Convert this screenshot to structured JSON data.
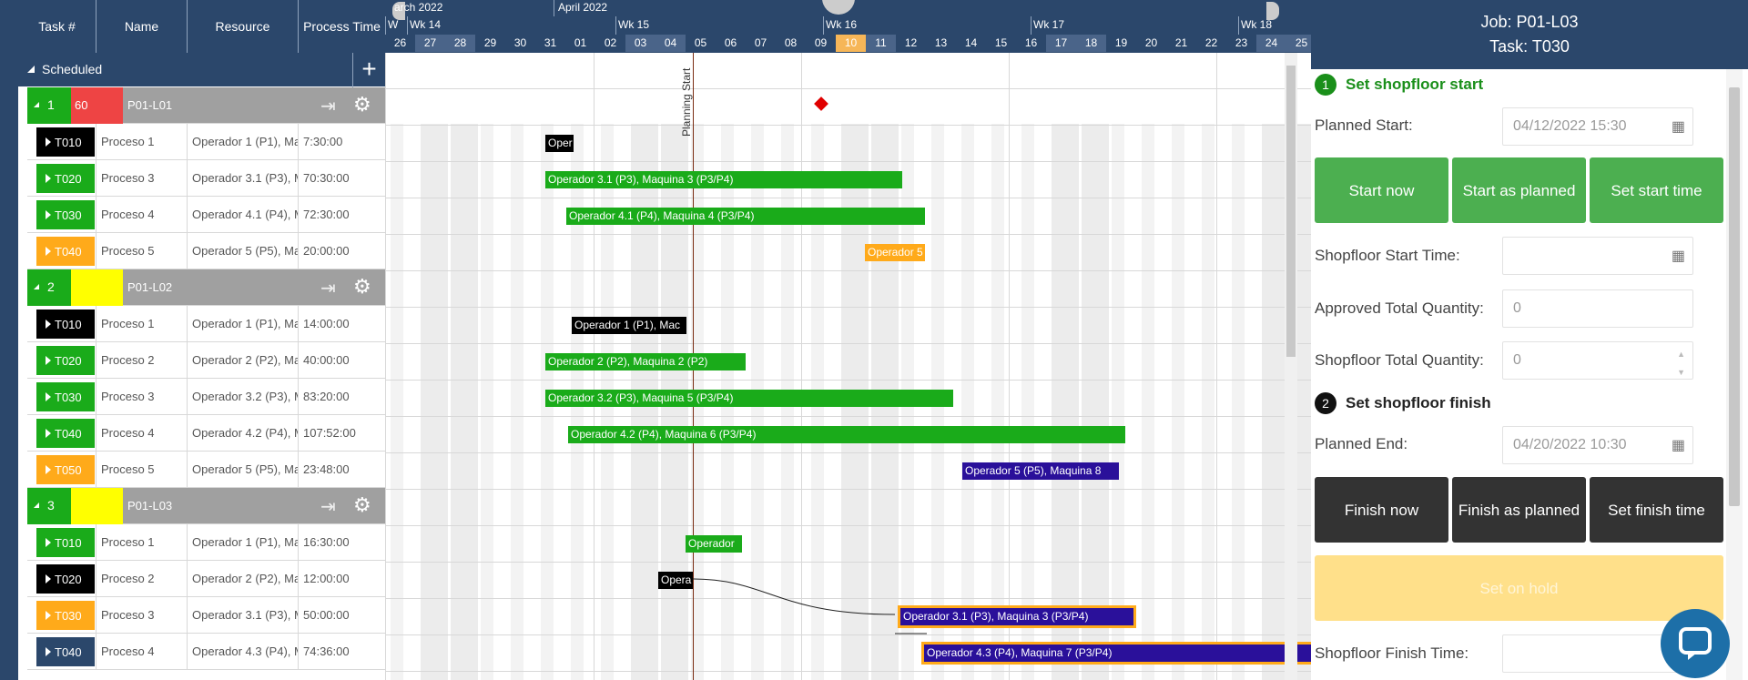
{
  "grid": {
    "headers": [
      "Task #",
      "Name",
      "Resource",
      "Process Time"
    ],
    "scheduled_label": "Scheduled",
    "plus": "+"
  },
  "jobs": [
    {
      "num": "1",
      "priority": "60",
      "priority_color": "#ee4444",
      "name": "P01-L01",
      "num_color": "#1aab1a",
      "tasks": [
        {
          "id": "T010",
          "color": "#000000",
          "name": "Proceso 1",
          "resource": "Operador 1 (P1), Ma",
          "time": "7:30:00"
        },
        {
          "id": "T020",
          "color": "#1aab1a",
          "name": "Proceso 3",
          "resource": "Operador 3.1 (P3), M",
          "time": "70:30:00"
        },
        {
          "id": "T030",
          "color": "#1aab1a",
          "name": "Proceso 4",
          "resource": "Operador 4.1 (P4), M",
          "time": "72:30:00"
        },
        {
          "id": "T040",
          "color": "#ffaa1a",
          "name": "Proceso 5",
          "resource": "Operador 5 (P5), Ma",
          "time": "20:00:00"
        }
      ]
    },
    {
      "num": "2",
      "priority": "",
      "priority_color": "#ffff00",
      "name": "P01-L02",
      "num_color": "#1aab1a",
      "tasks": [
        {
          "id": "T010",
          "color": "#000000",
          "name": "Proceso 1",
          "resource": "Operador 1 (P1), Ma",
          "time": "14:00:00"
        },
        {
          "id": "T020",
          "color": "#1aab1a",
          "name": "Proceso 2",
          "resource": "Operador 2 (P2), Ma",
          "time": "40:00:00"
        },
        {
          "id": "T030",
          "color": "#1aab1a",
          "name": "Proceso 3",
          "resource": "Operador 3.2 (P3), M",
          "time": "83:20:00"
        },
        {
          "id": "T040",
          "color": "#1aab1a",
          "name": "Proceso 4",
          "resource": "Operador 4.2 (P4), M",
          "time": "107:52:00"
        },
        {
          "id": "T050",
          "color": "#ffaa1a",
          "name": "Proceso 5",
          "resource": "Operador 5 (P5), Ma",
          "time": "23:48:00"
        }
      ]
    },
    {
      "num": "3",
      "priority": "",
      "priority_color": "#ffff00",
      "name": "P01-L03",
      "num_color": "#1aab1a",
      "tasks": [
        {
          "id": "T010",
          "color": "#1aab1a",
          "name": "Proceso 1",
          "resource": "Operador 1 (P1), Ma",
          "time": "16:30:00"
        },
        {
          "id": "T020",
          "color": "#000000",
          "name": "Proceso 2",
          "resource": "Operador 2 (P2), Ma",
          "time": "12:00:00"
        },
        {
          "id": "T030",
          "color": "#ffaa1a",
          "name": "Proceso 3",
          "resource": "Operador 3.1 (P3), M",
          "time": "50:00:00"
        },
        {
          "id": "T040",
          "color": "#2b476b",
          "name": "Proceso 4",
          "resource": "Operador 4.3 (P4), M",
          "time": "74:36:00"
        }
      ]
    }
  ],
  "timeline": {
    "months": [
      {
        "label": "arch 2022"
      },
      {
        "label": "April 2022"
      }
    ],
    "weeks": [
      "W",
      "Wk 14",
      "Wk 15",
      "Wk 16",
      "Wk 17",
      "Wk 18"
    ],
    "days": [
      "26",
      "27",
      "28",
      "29",
      "30",
      "31",
      "01",
      "02",
      "03",
      "04",
      "05",
      "06",
      "07",
      "08",
      "09",
      "10",
      "11",
      "12",
      "13",
      "14",
      "15",
      "16",
      "17",
      "18",
      "19",
      "20",
      "21",
      "22",
      "23",
      "24",
      "25"
    ],
    "today": "10",
    "planning_start": "Planning Start"
  },
  "bars": [
    {
      "text": "Oper",
      "color": "#000000"
    },
    {
      "text": "Operador 3.1 (P3), Maquina 3 (P3/P4)",
      "color": "#1aab1a"
    },
    {
      "text": "Operador 4.1 (P4), Maquina 4 (P3/P4)",
      "color": "#1aab1a"
    },
    {
      "text": "Operador 5",
      "color": "#ffaa1a"
    },
    {
      "text": "Operador 1 (P1), Mac",
      "color": "#000000"
    },
    {
      "text": "Operador 2 (P2), Maquina 2 (P2)",
      "color": "#1aab1a"
    },
    {
      "text": "Operador 3.2 (P3), Maquina 5 (P3/P4)",
      "color": "#1aab1a"
    },
    {
      "text": "Operador 4.2 (P4), Maquina 6 (P3/P4)",
      "color": "#1aab1a"
    },
    {
      "text": "Operador 5 (P5), Maquina 8",
      "color": "#2a109a"
    },
    {
      "text": "Operador",
      "color": "#1aab1a"
    },
    {
      "text": "Opera",
      "color": "#000000"
    },
    {
      "text": "Operador 3.1 (P3), Maquina 3 (P3/P4)",
      "color": "#2a109a"
    },
    {
      "text": "Operador 4.3 (P4), Maquina 7 (P3/P4)",
      "color": "#2a109a"
    }
  ],
  "panel": {
    "job_title": "Job: P01-L03",
    "task_title": "Task: T030",
    "step1_num": "1",
    "step1_title": "Set shopfloor start",
    "planned_start_label": "Planned Start:",
    "planned_start_value": "04/12/2022 15:30",
    "start_now": "Start now",
    "start_as_planned": "Start as planned",
    "set_start_time": "Set start time",
    "shopfloor_start_label": "Shopfloor Start Time:",
    "shopfloor_start_value": "",
    "approved_qty_label": "Approved Total Quantity:",
    "approved_qty_value": "0",
    "shopfloor_qty_label": "Shopfloor Total Quantity:",
    "shopfloor_qty_value": "0",
    "step2_num": "2",
    "step2_title": "Set shopfloor finish",
    "planned_end_label": "Planned End:",
    "planned_end_value": "04/20/2022 10:30",
    "finish_now": "Finish now",
    "finish_as_planned": "Finish as planned",
    "set_finish_time": "Set finish time",
    "set_on_hold": "Set on hold",
    "shopfloor_finish_label": "Shopfloor Finish Time:",
    "colors": {
      "green": "#4caf50",
      "dark": "#333333",
      "hold": "#ffe08a",
      "step1": "#1a8f1a"
    }
  }
}
